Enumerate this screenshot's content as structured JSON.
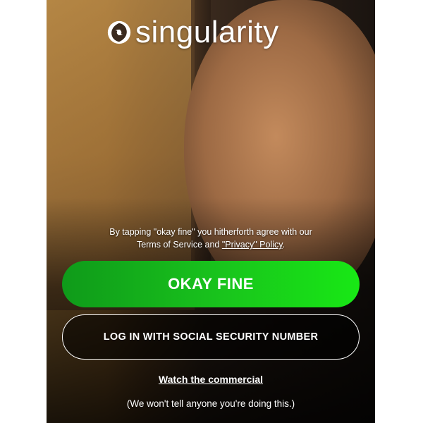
{
  "app": {
    "logo_text": "singularity",
    "logo_icon": "swirl-logo-icon"
  },
  "terms": {
    "line1": "By tapping \"okay fine\" you hitherforth agree with our",
    "terms_prefix": "Terms of Service and ",
    "privacy_link": "\"Privacy\" Policy",
    "terms_suffix": "."
  },
  "actions": {
    "primary_label": "OKAY FINE",
    "secondary_label": "LOG IN WITH SOCIAL SECURITY NUMBER",
    "watch_link": "Watch the commercial",
    "disclaimer": "(We won't tell anyone you're doing this.)"
  },
  "colors": {
    "primary_start": "#0f9a1a",
    "primary_end": "#18e815",
    "text": "#ffffff"
  }
}
